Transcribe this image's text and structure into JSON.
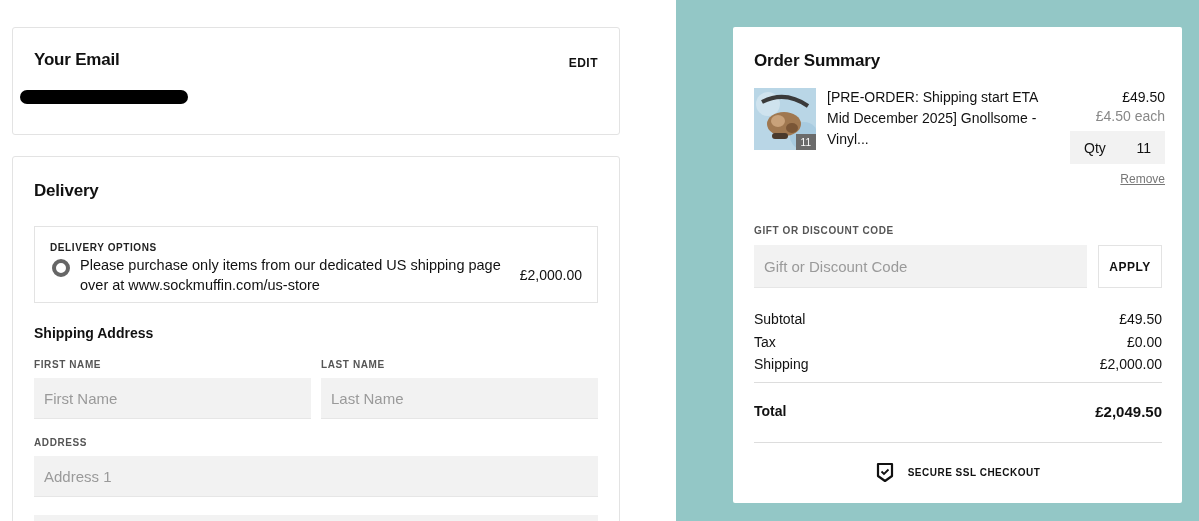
{
  "email_section": {
    "title": "Your Email",
    "edit_link": "EDIT"
  },
  "delivery_section": {
    "title": "Delivery",
    "options_label": "DELIVERY OPTIONS",
    "options": [
      {
        "label": "Please purchase only items from our dedicated US shipping page over at www.sockmuffin.com/us-store",
        "price": "£2,000.00",
        "selected": true
      }
    ],
    "address_title": "Shipping Address",
    "fields": [
      {
        "label": "FIRST NAME",
        "placeholder": "First Name"
      },
      {
        "label": "LAST NAME",
        "placeholder": "Last Name"
      },
      {
        "label": "ADDRESS",
        "placeholder": "Address 1"
      }
    ]
  },
  "order_summary": {
    "title": "Order Summary",
    "items": [
      {
        "kind": "picture",
        "quantity_badge": "11",
        "name": "[PRE-ORDER: Shipping start ETA Mid December 2025] Gnollsome - Vinyl...",
        "price": "£49.50",
        "unit_price": "£4.50 each",
        "qty_label": "Qty",
        "qty": "11",
        "remove": "Remove"
      }
    ],
    "discount": {
      "label": "GIFT OR DISCOUNT CODE",
      "placeholder": "Gift or Discount Code",
      "button": "APPLY"
    },
    "totals": [
      {
        "label": "Subtotal",
        "value": "£49.50"
      },
      {
        "label": "Tax",
        "value": "£0.00"
      },
      {
        "label": "Shipping",
        "value": "£2,000.00"
      }
    ],
    "total": {
      "label": "Total",
      "value": "£2,049.50"
    },
    "secure_note": "SECURE SSL CHECKOUT"
  }
}
